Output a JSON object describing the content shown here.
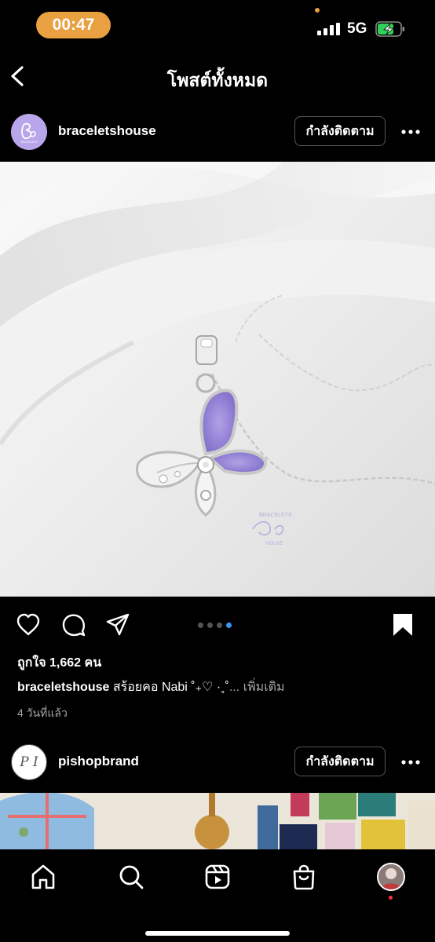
{
  "status": {
    "time": "00:47",
    "network": "5G"
  },
  "header": {
    "title": "โพสต์ทั้งหมด"
  },
  "posts": [
    {
      "username": "braceletshouse",
      "follow_label": "กำลังติดตาม",
      "watermark": "BRACELETS HOUSE",
      "likes": "ถูกใจ 1,662 คน",
      "caption_user": "braceletshouse",
      "caption_text": " สร้อยคอ Nabi ˚₊♡ ·˳˚",
      "caption_more": "... เพิ่มเติม",
      "age": "4 วันที่แล้ว",
      "carousel": {
        "count": 4,
        "active": 4
      }
    },
    {
      "username": "pishopbrand",
      "avatar_text": "P I",
      "follow_label": "กำลังติดตาม"
    }
  ],
  "nav": {
    "items": [
      "home-icon",
      "search-icon",
      "reels-icon",
      "shop-icon",
      "profile-avatar"
    ]
  },
  "colors": {
    "accent": "#3897f0",
    "time_pill": "#e9a040",
    "battery": "#30d158"
  }
}
